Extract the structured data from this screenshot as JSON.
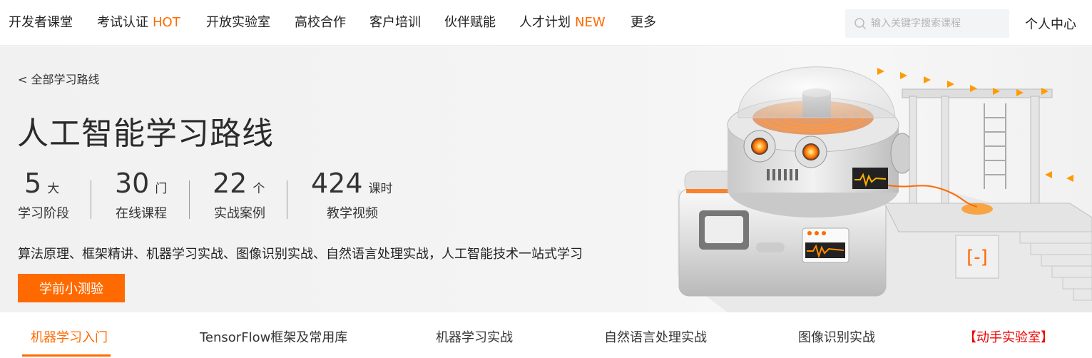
{
  "nav": {
    "items": [
      {
        "label": "开发者课堂",
        "tag": ""
      },
      {
        "label": "考试认证",
        "tag": "HOT"
      },
      {
        "label": "开放实验室",
        "tag": ""
      },
      {
        "label": "高校合作",
        "tag": ""
      },
      {
        "label": "客户培训",
        "tag": ""
      },
      {
        "label": "伙伴赋能",
        "tag": ""
      },
      {
        "label": "人才计划",
        "tag": "NEW"
      },
      {
        "label": "更多",
        "tag": ""
      }
    ],
    "search_placeholder": "输入关键字搜索课程",
    "personal_center": "个人中心",
    "accent_color": "#ff6a00"
  },
  "hero": {
    "back_link": "< 全部学习路线",
    "title": "人工智能学习路线",
    "stats": [
      {
        "num": "5",
        "unit": "大",
        "label": "学习阶段"
      },
      {
        "num": "30",
        "unit": "门",
        "label": "在线课程"
      },
      {
        "num": "22",
        "unit": "个",
        "label": "实战案例"
      },
      {
        "num": "424",
        "unit": "课时",
        "label": "教学视频"
      }
    ],
    "description": "算法原理、框架精讲、机器学习实战、图像识别实战、自然语言处理实战，人工智能技术一站式学习",
    "quiz_button": "学前小测验"
  },
  "tabs": {
    "items": [
      {
        "label": "机器学习入门",
        "active": true
      },
      {
        "label": "TensorFlow框架及常用库",
        "active": false
      },
      {
        "label": "机器学习实战",
        "active": false
      },
      {
        "label": "自然语言处理实战",
        "active": false
      },
      {
        "label": "图像识别实战",
        "active": false
      },
      {
        "label": "【动手实验室】",
        "active": false
      }
    ]
  }
}
